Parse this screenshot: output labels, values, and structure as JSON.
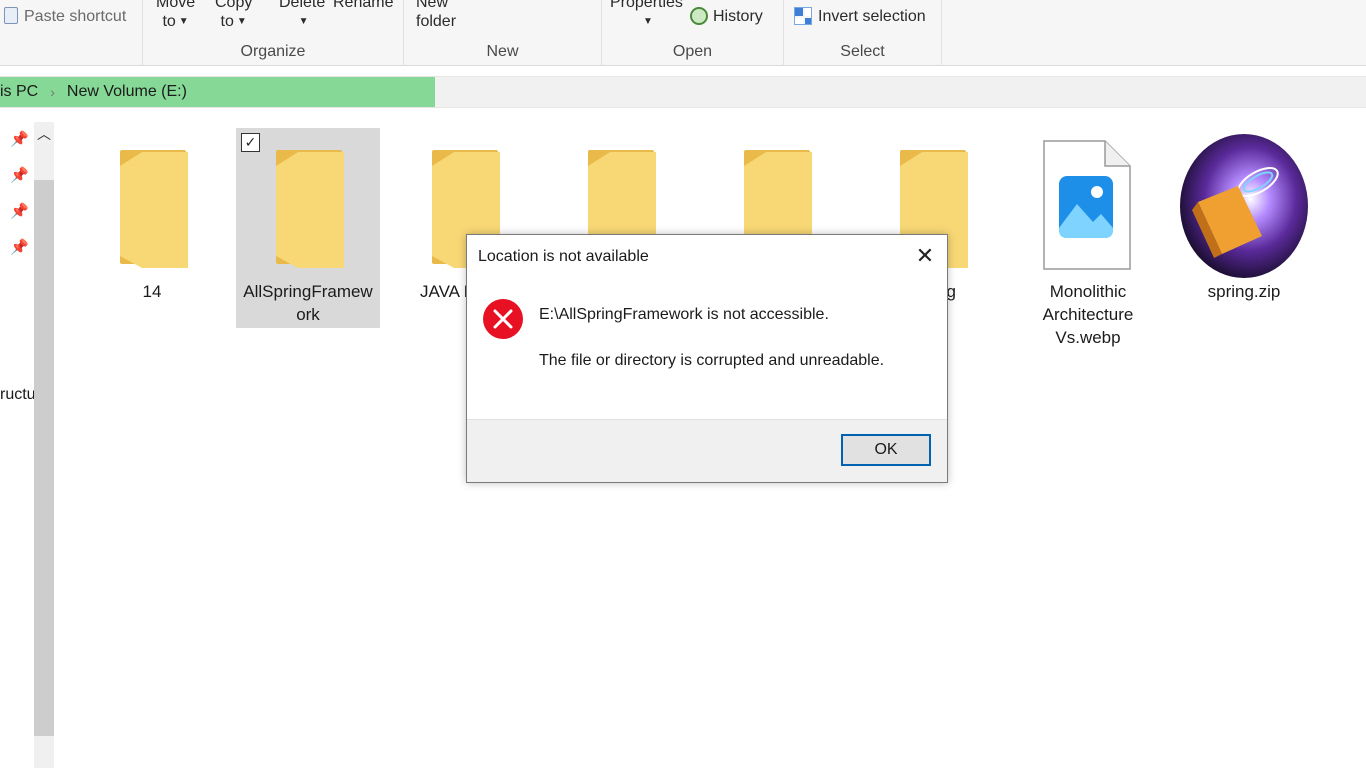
{
  "ribbon": {
    "paste_shortcut": "Paste shortcut",
    "move_to": [
      "Move",
      "to"
    ],
    "copy_to": [
      "Copy",
      "to"
    ],
    "delete": "Delete",
    "rename": "Rename",
    "new_folder": [
      "New",
      "folder"
    ],
    "properties": "Properties",
    "history": "History",
    "invert_selection": "Invert selection",
    "groups": {
      "organize": "Organize",
      "new": "New",
      "open": "Open",
      "select": "Select"
    }
  },
  "address": {
    "crumbs": [
      "is PC",
      "New Volume (E:)"
    ],
    "separator": "›"
  },
  "nav": {
    "truncated_item": "ructu"
  },
  "files": [
    {
      "name": "14",
      "type": "folder"
    },
    {
      "name": "AllSpringFramew ork",
      "type": "folder",
      "selected": true
    },
    {
      "name": "JAVA N",
      "type": "folder"
    },
    {
      "name": "",
      "type": "folder"
    },
    {
      "name": "",
      "type": "folder"
    },
    {
      "name": "g",
      "type": "folder"
    },
    {
      "name": "Monolithic Architecture Vs.webp",
      "type": "image-file"
    },
    {
      "name": "spring.zip",
      "type": "zip-image"
    }
  ],
  "dialog": {
    "title": "Location is not available",
    "message": "E:\\AllSpringFramework is not accessible.",
    "detail": "The file or directory is corrupted and unreadable.",
    "ok": "OK",
    "close": "✕"
  },
  "colors": {
    "folder": "#f8d775",
    "folder_dark": "#e9b949",
    "error": "#e81123",
    "accent": "#0063b1",
    "progress": "#85d895"
  }
}
